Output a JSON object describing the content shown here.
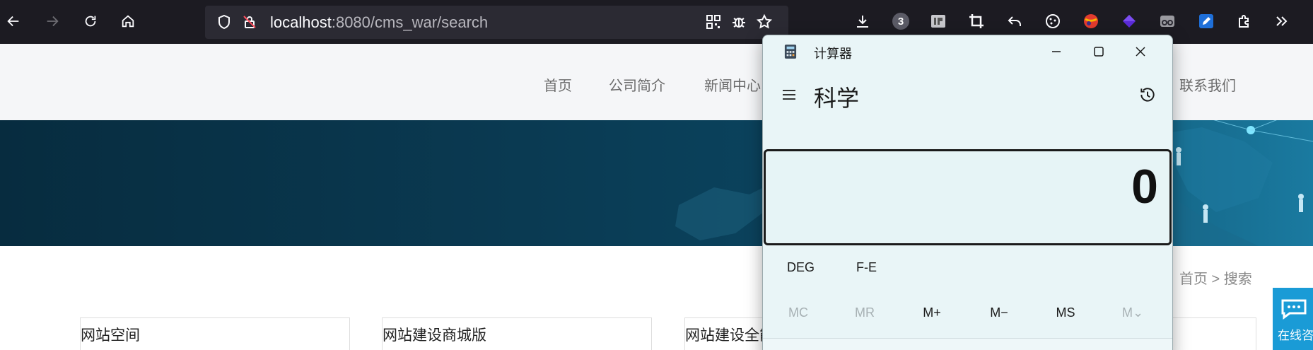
{
  "browser": {
    "url_host": "localhost",
    "url_rest": ":8080/cms_war/search",
    "badge_count": "3"
  },
  "site": {
    "nav": {
      "home": "首页",
      "about": "公司简介",
      "news": "新闻中心",
      "contact": "联系我们"
    },
    "breadcrumb": "首页 > 搜索",
    "cards": [
      "网站空间",
      "网站建设商城版",
      "网站建设全能"
    ],
    "consult_label": "在线咨",
    "banner_color": "#0a3a52"
  },
  "calculator": {
    "title": "计算器",
    "mode": "科学",
    "display": "0",
    "angle_mode": "DEG",
    "notation_toggle": "F-E",
    "memory": [
      "MC",
      "MR",
      "M+",
      "M−",
      "MS",
      "M⌄"
    ]
  }
}
